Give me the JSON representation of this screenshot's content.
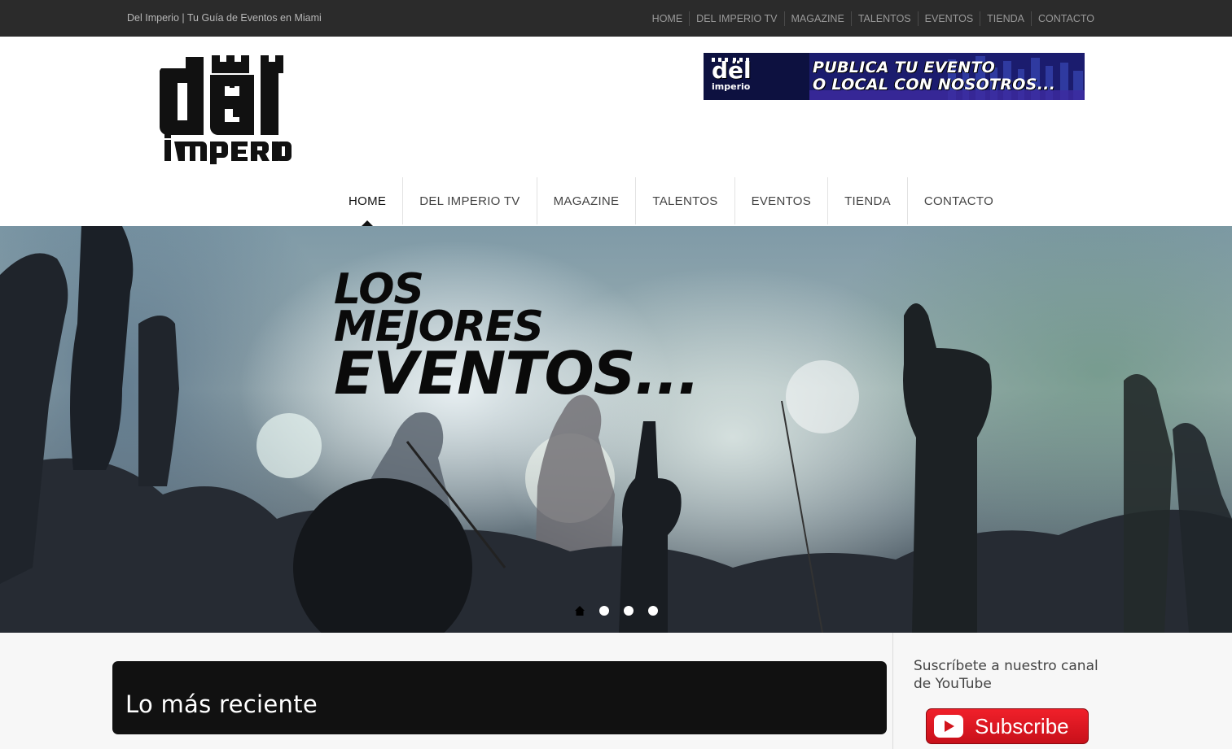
{
  "topbar": {
    "tagline": "Del Imperio | Tu Guía de Eventos en Miami",
    "links": [
      "HOME",
      "DEL IMPERIO TV",
      "MAGAZINE",
      "TALENTOS",
      "EVENTOS",
      "TIENDA",
      "CONTACTO"
    ]
  },
  "logo": {
    "line1": "dël",
    "line2": "imPeRio"
  },
  "banner": {
    "logo_line1": "dël",
    "logo_line2": "imperio",
    "line1": "PUBLICA TU EVENTO",
    "line2": "O LOCAL CON NOSOTROS..."
  },
  "mainnav": {
    "items": [
      "HOME",
      "DEL IMPERIO TV",
      "MAGAZINE",
      "TALENTOS",
      "EVENTOS",
      "TIENDA",
      "CONTACTO"
    ],
    "active": "HOME"
  },
  "hero": {
    "line1": "LOS",
    "line2": "MEJORES",
    "line3": "EVENTOS...",
    "slides": 4,
    "current_slide": 1
  },
  "content": {
    "recent_title": "Lo más reciente",
    "sidebar_title": "Suscríbete a nuestro canal de YouTube",
    "subscribe_label": "Subscribe"
  },
  "colors": {
    "topbar": "#2b2b2b",
    "accent_red": "#e0141c",
    "dark_box": "#111111"
  }
}
